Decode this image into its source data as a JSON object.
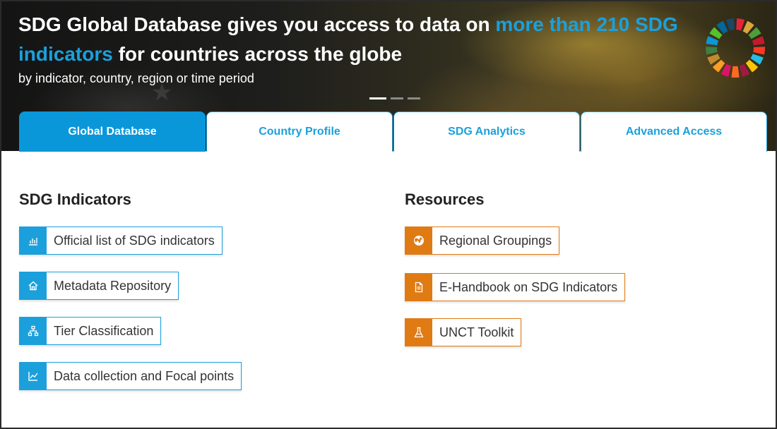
{
  "hero": {
    "title_part1": "SDG Global Database gives you access to data on ",
    "title_highlight": "more than 210 SDG indicators",
    "title_part2": " for countries across the globe",
    "subtitle": "by indicator, country, region or time period",
    "highlight_color": "#1ba0dc",
    "carousel_slides": 3,
    "carousel_active": 1
  },
  "tabs": [
    {
      "label": "Global Database",
      "active": true
    },
    {
      "label": "Country Profile",
      "active": false
    },
    {
      "label": "SDG Analytics",
      "active": false
    },
    {
      "label": "Advanced Access",
      "active": false
    }
  ],
  "sdg_indicators": {
    "title": "SDG Indicators",
    "items": [
      {
        "label": "Official list of SDG indicators",
        "icon": "bar-chart-icon"
      },
      {
        "label": "Metadata Repository",
        "icon": "home-icon"
      },
      {
        "label": "Tier Classification",
        "icon": "hierarchy-icon"
      },
      {
        "label": "Data collection and Focal points",
        "icon": "line-chart-icon"
      }
    ]
  },
  "resources": {
    "title": "Resources",
    "items": [
      {
        "label": "Regional Groupings",
        "icon": "globe-icon"
      },
      {
        "label": "E-Handbook on SDG Indicators",
        "icon": "document-icon"
      },
      {
        "label": "UNCT Toolkit",
        "icon": "flask-icon"
      }
    ]
  },
  "colors": {
    "accent_blue": "#1ba0dc",
    "active_tab": "#0a97d9",
    "accent_orange": "#e07b14",
    "text_dark": "#222222"
  }
}
